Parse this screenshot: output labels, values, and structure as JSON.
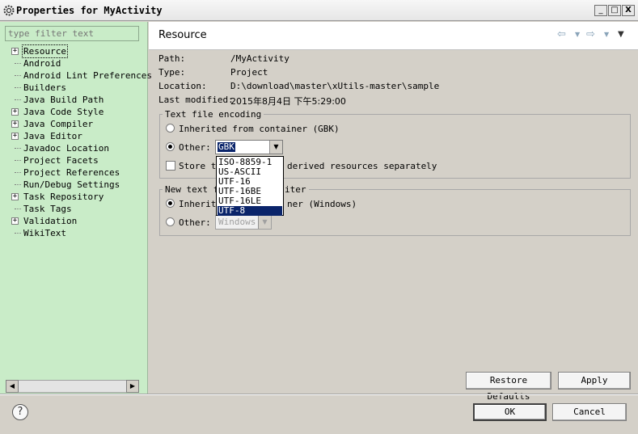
{
  "window": {
    "title": "Properties for MyActivity",
    "minimize": "_",
    "maximize": "□",
    "close": "X"
  },
  "filter": {
    "placeholder": "type filter text"
  },
  "tree": {
    "items": [
      {
        "label": "Resource",
        "expandable": true,
        "selected": true
      },
      {
        "label": "Android",
        "expandable": false
      },
      {
        "label": "Android Lint Preferences",
        "expandable": false
      },
      {
        "label": "Builders",
        "expandable": false
      },
      {
        "label": "Java Build Path",
        "expandable": false
      },
      {
        "label": "Java Code Style",
        "expandable": true
      },
      {
        "label": "Java Compiler",
        "expandable": true
      },
      {
        "label": "Java Editor",
        "expandable": true
      },
      {
        "label": "Javadoc Location",
        "expandable": false
      },
      {
        "label": "Project Facets",
        "expandable": false
      },
      {
        "label": "Project References",
        "expandable": false
      },
      {
        "label": "Run/Debug Settings",
        "expandable": false
      },
      {
        "label": "Task Repository",
        "expandable": true
      },
      {
        "label": "Task Tags",
        "expandable": false
      },
      {
        "label": "Validation",
        "expandable": true
      },
      {
        "label": "WikiText",
        "expandable": false
      }
    ]
  },
  "header": {
    "title": "Resource"
  },
  "props": {
    "path_label": "Path:",
    "path_value": "/MyActivity",
    "type_label": "Type:",
    "type_value": "Project",
    "location_label": "Location:",
    "location_value": "D:\\download\\master\\xUtils-master\\sample",
    "modified_label": "Last modified:",
    "modified_value": "2015年8月4日 下午5:29:00"
  },
  "encoding": {
    "group_title": "Text file encoding",
    "inherited_label": "Inherited from container (GBK)",
    "other_label": "Other:",
    "combo_value": "GBK",
    "store_label": "Store the encoding of derived resources separately",
    "store_label_visible": "derived resources separately",
    "store_label_prefix": "Store th",
    "options": [
      "ISO-8859-1",
      "US-ASCII",
      "UTF-16",
      "UTF-16BE",
      "UTF-16LE",
      "UTF-8"
    ]
  },
  "delimiter": {
    "group_title_prefix": "New text f",
    "group_title_suffix": "iter",
    "inherited_prefix": "Inherit",
    "inherited_suffix": "ner (Windows)",
    "other_label": "Other:",
    "combo_value": "Windows"
  },
  "buttons": {
    "restore": "Restore Defaults",
    "apply": "Apply",
    "ok": "OK",
    "cancel": "Cancel",
    "help": "?"
  }
}
